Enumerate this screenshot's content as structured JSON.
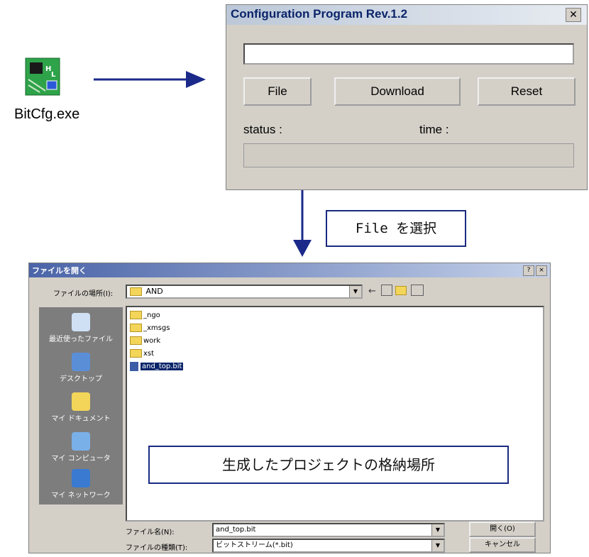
{
  "desktop": {
    "app_label": "BitCfg.exe"
  },
  "config_window": {
    "title": "Configuration Program  Rev.1.2",
    "close": "✕",
    "file_button": "File",
    "download_button": "Download",
    "reset_button": "Reset",
    "status_label": "status :",
    "time_label": "time :"
  },
  "annotation": {
    "select_file": "File を選択",
    "project_location": "生成したプロジェクトの格納場所"
  },
  "open_dialog": {
    "title": "ファイルを開く",
    "help": "?",
    "close": "×",
    "look_in_label": "ファイルの場所(I):",
    "look_in_value": "AND",
    "places": [
      "最近使ったファイル",
      "デスクトップ",
      "マイ ドキュメント",
      "マイ コンピュータ",
      "マイ ネットワーク"
    ],
    "items": [
      "_ngo",
      "_xmsgs",
      "work",
      "xst",
      "and_top.bit"
    ],
    "filename_label": "ファイル名(N):",
    "filename_value": "and_top.bit",
    "filetype_label": "ファイルの種類(T):",
    "filetype_value": "ビットストリーム(*.bit)",
    "open_button": "開く(O)",
    "cancel_button": "キャンセル"
  },
  "colors": {
    "arrow": "#1b2a8a",
    "title_text": "#0a246a",
    "selection": "#0a246a"
  }
}
